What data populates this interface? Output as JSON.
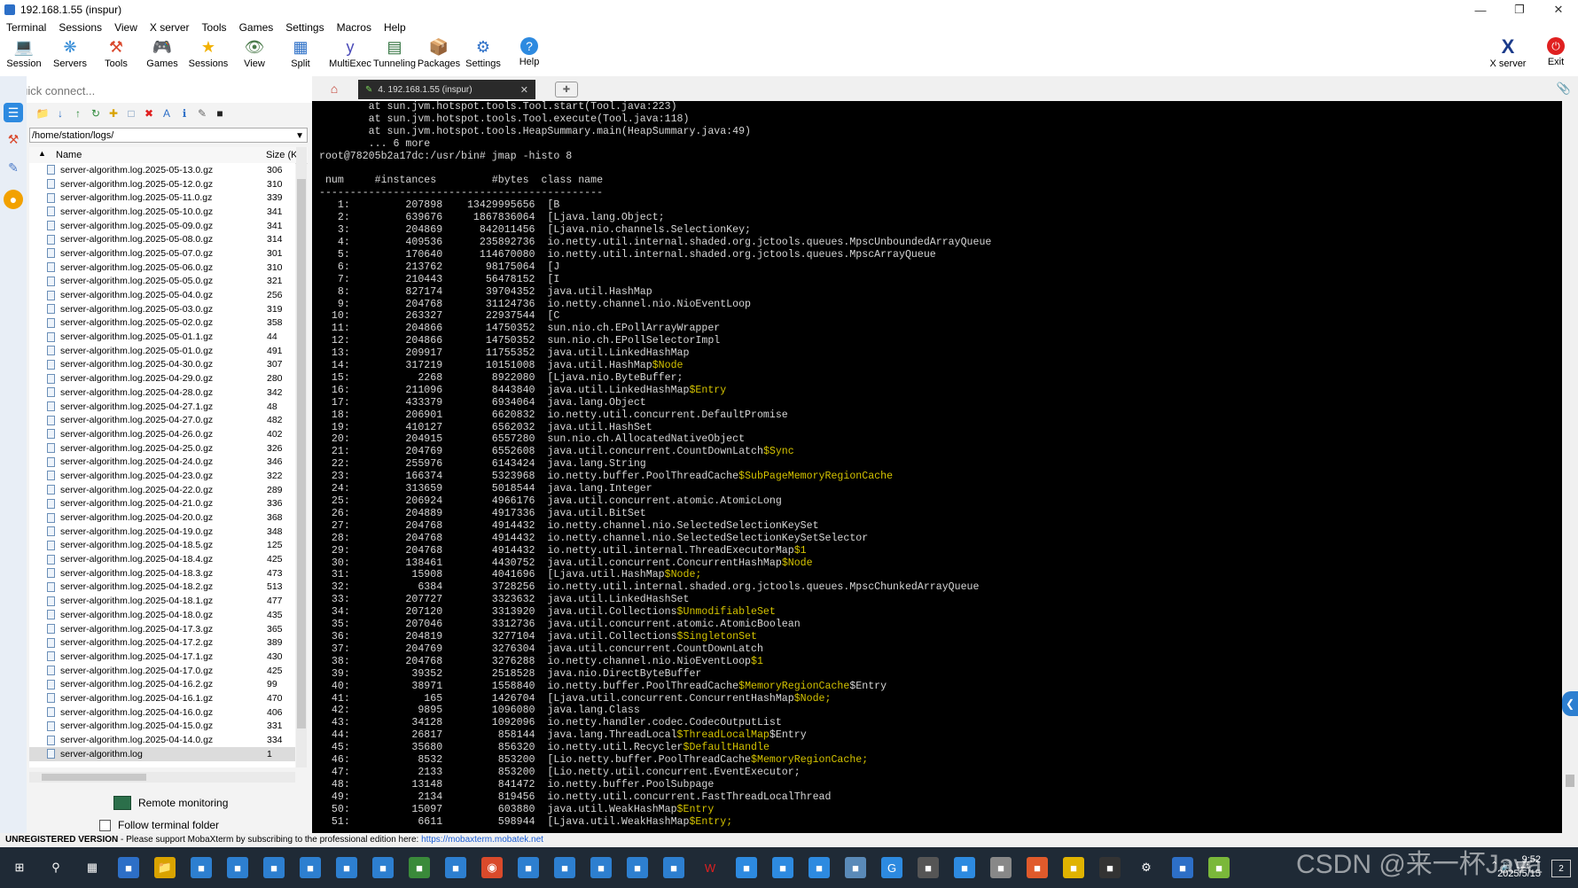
{
  "window": {
    "title": "192.168.1.55 (inspur)"
  },
  "menu": [
    "Terminal",
    "Sessions",
    "View",
    "X server",
    "Tools",
    "Games",
    "Settings",
    "Macros",
    "Help"
  ],
  "toolbar": [
    {
      "label": "Session",
      "icon": "session-icon",
      "color": "#2c6fc7"
    },
    {
      "label": "Servers",
      "icon": "servers-icon",
      "color": "#3a8fd8"
    },
    {
      "label": "Tools",
      "icon": "tools-icon",
      "color": "#d9472b"
    },
    {
      "label": "Games",
      "icon": "games-icon",
      "color": "#7a7a7a"
    },
    {
      "label": "Sessions",
      "icon": "star-icon",
      "color": "#f2b100"
    },
    {
      "label": "View",
      "icon": "view-icon",
      "color": "#4a7a4a"
    },
    {
      "label": "Split",
      "icon": "split-icon",
      "color": "#2c6fc7"
    },
    {
      "label": "MultiExec",
      "icon": "multiexec-icon",
      "color": "#4a4ab8"
    },
    {
      "label": "Tunneling",
      "icon": "tunneling-icon",
      "color": "#2c6f3a"
    },
    {
      "label": "Packages",
      "icon": "packages-icon",
      "color": "#5a6fb8"
    },
    {
      "label": "Settings",
      "icon": "gear-icon",
      "color": "#2c6fc7"
    },
    {
      "label": "Help",
      "icon": "help-icon",
      "color": "#2d8ae0"
    },
    {
      "label": "X server",
      "icon": "xserver-icon",
      "color": "#1a3a8a"
    },
    {
      "label": "Exit",
      "icon": "power-icon",
      "color": "#e02020"
    }
  ],
  "quick_connect": {
    "placeholder": "Quick connect..."
  },
  "file_panel": {
    "path": "/home/station/logs/",
    "col_name": "Name",
    "col_size": "Size (KB",
    "files": [
      {
        "name": "server-algorithm.log.2025-05-13.0.gz",
        "size": "306"
      },
      {
        "name": "server-algorithm.log.2025-05-12.0.gz",
        "size": "310"
      },
      {
        "name": "server-algorithm.log.2025-05-11.0.gz",
        "size": "339"
      },
      {
        "name": "server-algorithm.log.2025-05-10.0.gz",
        "size": "341"
      },
      {
        "name": "server-algorithm.log.2025-05-09.0.gz",
        "size": "341"
      },
      {
        "name": "server-algorithm.log.2025-05-08.0.gz",
        "size": "314"
      },
      {
        "name": "server-algorithm.log.2025-05-07.0.gz",
        "size": "301"
      },
      {
        "name": "server-algorithm.log.2025-05-06.0.gz",
        "size": "310"
      },
      {
        "name": "server-algorithm.log.2025-05-05.0.gz",
        "size": "321"
      },
      {
        "name": "server-algorithm.log.2025-05-04.0.gz",
        "size": "256"
      },
      {
        "name": "server-algorithm.log.2025-05-03.0.gz",
        "size": "319"
      },
      {
        "name": "server-algorithm.log.2025-05-02.0.gz",
        "size": "358"
      },
      {
        "name": "server-algorithm.log.2025-05-01.1.gz",
        "size": "44"
      },
      {
        "name": "server-algorithm.log.2025-05-01.0.gz",
        "size": "491"
      },
      {
        "name": "server-algorithm.log.2025-04-30.0.gz",
        "size": "307"
      },
      {
        "name": "server-algorithm.log.2025-04-29.0.gz",
        "size": "280"
      },
      {
        "name": "server-algorithm.log.2025-04-28.0.gz",
        "size": "342"
      },
      {
        "name": "server-algorithm.log.2025-04-27.1.gz",
        "size": "48"
      },
      {
        "name": "server-algorithm.log.2025-04-27.0.gz",
        "size": "482"
      },
      {
        "name": "server-algorithm.log.2025-04-26.0.gz",
        "size": "402"
      },
      {
        "name": "server-algorithm.log.2025-04-25.0.gz",
        "size": "326"
      },
      {
        "name": "server-algorithm.log.2025-04-24.0.gz",
        "size": "346"
      },
      {
        "name": "server-algorithm.log.2025-04-23.0.gz",
        "size": "322"
      },
      {
        "name": "server-algorithm.log.2025-04-22.0.gz",
        "size": "289"
      },
      {
        "name": "server-algorithm.log.2025-04-21.0.gz",
        "size": "336"
      },
      {
        "name": "server-algorithm.log.2025-04-20.0.gz",
        "size": "368"
      },
      {
        "name": "server-algorithm.log.2025-04-19.0.gz",
        "size": "348"
      },
      {
        "name": "server-algorithm.log.2025-04-18.5.gz",
        "size": "125"
      },
      {
        "name": "server-algorithm.log.2025-04-18.4.gz",
        "size": "425"
      },
      {
        "name": "server-algorithm.log.2025-04-18.3.gz",
        "size": "473"
      },
      {
        "name": "server-algorithm.log.2025-04-18.2.gz",
        "size": "513"
      },
      {
        "name": "server-algorithm.log.2025-04-18.1.gz",
        "size": "477"
      },
      {
        "name": "server-algorithm.log.2025-04-18.0.gz",
        "size": "435"
      },
      {
        "name": "server-algorithm.log.2025-04-17.3.gz",
        "size": "365"
      },
      {
        "name": "server-algorithm.log.2025-04-17.2.gz",
        "size": "389"
      },
      {
        "name": "server-algorithm.log.2025-04-17.1.gz",
        "size": "430"
      },
      {
        "name": "server-algorithm.log.2025-04-17.0.gz",
        "size": "425"
      },
      {
        "name": "server-algorithm.log.2025-04-16.2.gz",
        "size": "99"
      },
      {
        "name": "server-algorithm.log.2025-04-16.1.gz",
        "size": "470"
      },
      {
        "name": "server-algorithm.log.2025-04-16.0.gz",
        "size": "406"
      },
      {
        "name": "server-algorithm.log.2025-04-15.0.gz",
        "size": "331"
      },
      {
        "name": "server-algorithm.log.2025-04-14.0.gz",
        "size": "334"
      },
      {
        "name": "server-algorithm.log",
        "size": "1"
      }
    ],
    "remote_monitoring": "Remote monitoring",
    "follow_terminal": "Follow terminal folder"
  },
  "tab": {
    "label": "4. 192.168.1.55 (inspur)"
  },
  "terminal": {
    "pre": [
      "        at sun.jvm.hotspot.tools.Tool.start(Tool.java:223)",
      "        at sun.jvm.hotspot.tools.Tool.execute(Tool.java:118)",
      "        at sun.jvm.hotspot.tools.HeapSummary.main(HeapSummary.java:49)",
      "        ... 6 more",
      "root@78205b2a17dc:/usr/bin# jmap -histo 8",
      "",
      " num     #instances         #bytes  class name",
      "----------------------------------------------"
    ],
    "histo": [
      {
        "num": "1:",
        "inst": "207898",
        "bytes": "13429995656",
        "cls": "[B",
        "sfx": ""
      },
      {
        "num": "2:",
        "inst": "639676",
        "bytes": "1867836064",
        "cls": "[Ljava.lang.Object;",
        "sfx": ""
      },
      {
        "num": "3:",
        "inst": "204869",
        "bytes": "842011456",
        "cls": "[Ljava.nio.channels.SelectionKey;",
        "sfx": ""
      },
      {
        "num": "4:",
        "inst": "409536",
        "bytes": "235892736",
        "cls": "io.netty.util.internal.shaded.org.jctools.queues.MpscUnboundedArrayQueue",
        "sfx": ""
      },
      {
        "num": "5:",
        "inst": "170640",
        "bytes": "114670080",
        "cls": "io.netty.util.internal.shaded.org.jctools.queues.MpscArrayQueue",
        "sfx": ""
      },
      {
        "num": "6:",
        "inst": "213762",
        "bytes": "98175064",
        "cls": "[J",
        "sfx": ""
      },
      {
        "num": "7:",
        "inst": "210443",
        "bytes": "56478152",
        "cls": "[I",
        "sfx": ""
      },
      {
        "num": "8:",
        "inst": "827174",
        "bytes": "39704352",
        "cls": "java.util.HashMap",
        "sfx": ""
      },
      {
        "num": "9:",
        "inst": "204768",
        "bytes": "31124736",
        "cls": "io.netty.channel.nio.NioEventLoop",
        "sfx": ""
      },
      {
        "num": "10:",
        "inst": "263327",
        "bytes": "22937544",
        "cls": "[C",
        "sfx": ""
      },
      {
        "num": "11:",
        "inst": "204866",
        "bytes": "14750352",
        "cls": "sun.nio.ch.EPollArrayWrapper",
        "sfx": ""
      },
      {
        "num": "12:",
        "inst": "204866",
        "bytes": "14750352",
        "cls": "sun.nio.ch.EPollSelectorImpl",
        "sfx": ""
      },
      {
        "num": "13:",
        "inst": "209917",
        "bytes": "11755352",
        "cls": "java.util.LinkedHashMap",
        "sfx": ""
      },
      {
        "num": "14:",
        "inst": "317219",
        "bytes": "10151008",
        "cls": "java.util.HashMap",
        "sfx": "$Node"
      },
      {
        "num": "15:",
        "inst": "2268",
        "bytes": "8922080",
        "cls": "[Ljava.nio.ByteBuffer;",
        "sfx": ""
      },
      {
        "num": "16:",
        "inst": "211096",
        "bytes": "8443840",
        "cls": "java.util.LinkedHashMap",
        "sfx": "$Entry"
      },
      {
        "num": "17:",
        "inst": "433379",
        "bytes": "6934064",
        "cls": "java.lang.Object",
        "sfx": ""
      },
      {
        "num": "18:",
        "inst": "206901",
        "bytes": "6620832",
        "cls": "io.netty.util.concurrent.DefaultPromise",
        "sfx": ""
      },
      {
        "num": "19:",
        "inst": "410127",
        "bytes": "6562032",
        "cls": "java.util.HashSet",
        "sfx": ""
      },
      {
        "num": "20:",
        "inst": "204915",
        "bytes": "6557280",
        "cls": "sun.nio.ch.AllocatedNativeObject",
        "sfx": ""
      },
      {
        "num": "21:",
        "inst": "204769",
        "bytes": "6552608",
        "cls": "java.util.concurrent.CountDownLatch",
        "sfx": "$Sync"
      },
      {
        "num": "22:",
        "inst": "255976",
        "bytes": "6143424",
        "cls": "java.lang.String",
        "sfx": ""
      },
      {
        "num": "23:",
        "inst": "166374",
        "bytes": "5323968",
        "cls": "io.netty.buffer.PoolThreadCache",
        "sfx": "$SubPageMemoryRegionCache"
      },
      {
        "num": "24:",
        "inst": "313659",
        "bytes": "5018544",
        "cls": "java.lang.Integer",
        "sfx": ""
      },
      {
        "num": "25:",
        "inst": "206924",
        "bytes": "4966176",
        "cls": "java.util.concurrent.atomic.AtomicLong",
        "sfx": ""
      },
      {
        "num": "26:",
        "inst": "204889",
        "bytes": "4917336",
        "cls": "java.util.BitSet",
        "sfx": ""
      },
      {
        "num": "27:",
        "inst": "204768",
        "bytes": "4914432",
        "cls": "io.netty.channel.nio.SelectedSelectionKeySet",
        "sfx": ""
      },
      {
        "num": "28:",
        "inst": "204768",
        "bytes": "4914432",
        "cls": "io.netty.channel.nio.SelectedSelectionKeySetSelector",
        "sfx": ""
      },
      {
        "num": "29:",
        "inst": "204768",
        "bytes": "4914432",
        "cls": "io.netty.util.internal.ThreadExecutorMap",
        "sfx": "$1"
      },
      {
        "num": "30:",
        "inst": "138461",
        "bytes": "4430752",
        "cls": "java.util.concurrent.ConcurrentHashMap",
        "sfx": "$Node"
      },
      {
        "num": "31:",
        "inst": "15908",
        "bytes": "4041696",
        "cls": "[Ljava.util.HashMap",
        "sfx": "$Node;"
      },
      {
        "num": "32:",
        "inst": "6384",
        "bytes": "3728256",
        "cls": "io.netty.util.internal.shaded.org.jctools.queues.MpscChunkedArrayQueue",
        "sfx": ""
      },
      {
        "num": "33:",
        "inst": "207727",
        "bytes": "3323632",
        "cls": "java.util.LinkedHashSet",
        "sfx": ""
      },
      {
        "num": "34:",
        "inst": "207120",
        "bytes": "3313920",
        "cls": "java.util.Collections",
        "sfx": "$UnmodifiableSet"
      },
      {
        "num": "35:",
        "inst": "207046",
        "bytes": "3312736",
        "cls": "java.util.concurrent.atomic.AtomicBoolean",
        "sfx": ""
      },
      {
        "num": "36:",
        "inst": "204819",
        "bytes": "3277104",
        "cls": "java.util.Collections",
        "sfx": "$SingletonSet"
      },
      {
        "num": "37:",
        "inst": "204769",
        "bytes": "3276304",
        "cls": "java.util.concurrent.CountDownLatch",
        "sfx": ""
      },
      {
        "num": "38:",
        "inst": "204768",
        "bytes": "3276288",
        "cls": "io.netty.channel.nio.NioEventLoop",
        "sfx": "$1"
      },
      {
        "num": "39:",
        "inst": "39352",
        "bytes": "2518528",
        "cls": "java.nio.DirectByteBuffer",
        "sfx": ""
      },
      {
        "num": "40:",
        "inst": "38971",
        "bytes": "1558840",
        "cls": "io.netty.buffer.PoolThreadCache",
        "sfx": "$MemoryRegionCache",
        "tail": "$Entry"
      },
      {
        "num": "41:",
        "inst": "165",
        "bytes": "1426704",
        "cls": "[Ljava.util.concurrent.ConcurrentHashMap",
        "sfx": "$Node;"
      },
      {
        "num": "42:",
        "inst": "9895",
        "bytes": "1096080",
        "cls": "java.lang.Class",
        "sfx": ""
      },
      {
        "num": "43:",
        "inst": "34128",
        "bytes": "1092096",
        "cls": "io.netty.handler.codec.CodecOutputList",
        "sfx": ""
      },
      {
        "num": "44:",
        "inst": "26817",
        "bytes": "858144",
        "cls": "java.lang.ThreadLocal",
        "sfx": "$ThreadLocalMap",
        "tail": "$Entry"
      },
      {
        "num": "45:",
        "inst": "35680",
        "bytes": "856320",
        "cls": "io.netty.util.Recycler",
        "sfx": "$DefaultHandle"
      },
      {
        "num": "46:",
        "inst": "8532",
        "bytes": "853200",
        "cls": "[Lio.netty.buffer.PoolThreadCache",
        "sfx": "$MemoryRegionCache;"
      },
      {
        "num": "47:",
        "inst": "2133",
        "bytes": "853200",
        "cls": "[Lio.netty.util.concurrent.EventExecutor;",
        "sfx": ""
      },
      {
        "num": "48:",
        "inst": "13148",
        "bytes": "841472",
        "cls": "io.netty.buffer.PoolSubpage",
        "sfx": ""
      },
      {
        "num": "49:",
        "inst": "2134",
        "bytes": "819456",
        "cls": "io.netty.util.concurrent.FastThreadLocalThread",
        "sfx": ""
      },
      {
        "num": "50:",
        "inst": "15097",
        "bytes": "603880",
        "cls": "java.util.WeakHashMap",
        "sfx": "$Entry"
      },
      {
        "num": "51:",
        "inst": "6611",
        "bytes": "598944",
        "cls": "[Ljava.util.WeakHashMap",
        "sfx": "$Entry;"
      }
    ]
  },
  "status": {
    "unregistered": "UNREGISTERED VERSION",
    "message": " -  Please support MobaXterm by subscribing to the professional edition here: ",
    "link": "https://mobaxterm.mobatek.net"
  },
  "taskbar": {
    "time": "9:52",
    "date": "2025/5/15",
    "notifications": "2",
    "watermark": "CSDN @来一杯Java"
  },
  "colors": {
    "terminal_bg": "#000000",
    "terminal_fg": "#d6d6d6",
    "highlight": "#d4c300",
    "link": "#1b5ed6"
  }
}
